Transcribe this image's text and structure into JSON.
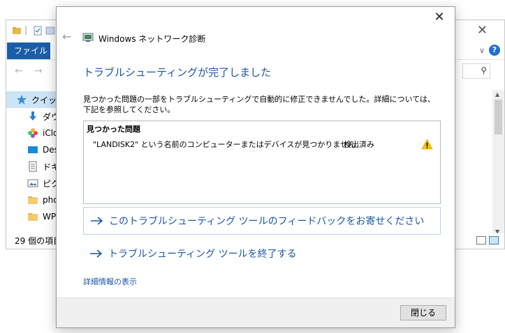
{
  "explorer": {
    "file_tab": "ファイル",
    "status": "29 個の項目",
    "sidebar": [
      {
        "label": "クイック",
        "icon": "star-icon"
      },
      {
        "label": "ダウ",
        "icon": "download-icon"
      },
      {
        "label": "iClo",
        "icon": "photos-icon"
      },
      {
        "label": "Des",
        "icon": "desktop-icon"
      },
      {
        "label": "ドキ",
        "icon": "document-icon"
      },
      {
        "label": "ピク",
        "icon": "pictures-icon"
      },
      {
        "label": "pho",
        "icon": "folder-icon"
      },
      {
        "label": "WP",
        "icon": "folder-icon"
      }
    ],
    "help_label": "?"
  },
  "dialog": {
    "title": "Windows ネットワーク診断",
    "heading": "トラブルシューティングが完了しました",
    "description": "見つかった問題の一部をトラブルシューティングで自動的に修正できませんでした。詳細については、下記を参照してください。",
    "problems_header": "見つかった問題",
    "problems": [
      {
        "text": "\"LANDISK2\" という名前のコンピューターまたはデバイスが見つかりません",
        "status": "検出済み",
        "icon": "warning-icon"
      }
    ],
    "feedback_link": "このトラブルシューティング ツールのフィードバックをお寄せください",
    "exit_link": "トラブルシューティング ツールを終了する",
    "details_link": "詳細情報の表示",
    "close_button": "閉じる"
  },
  "colors": {
    "accent_blue": "#1a55a8",
    "file_tab": "#1a5ea8",
    "warning": "#f5c400"
  }
}
